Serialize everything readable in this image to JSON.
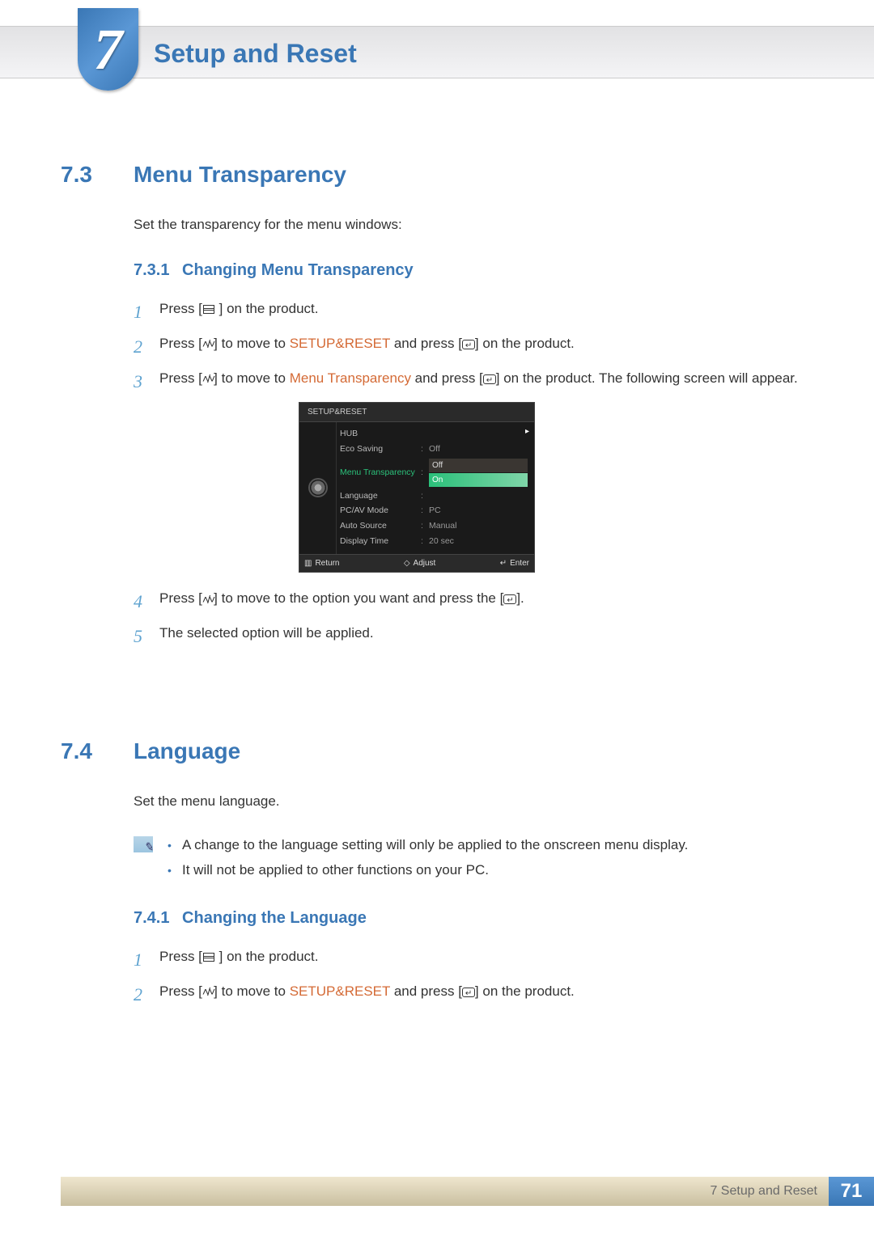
{
  "chapter": {
    "number": "7",
    "title": "Setup and Reset"
  },
  "section_73": {
    "num": "7.3",
    "title": "Menu Transparency",
    "intro": "Set the transparency for the menu windows:",
    "sub_num": "7.3.1",
    "sub_title": "Changing Menu Transparency",
    "step1": "on the product.",
    "step1_pre": "Press [",
    "step1_post": " ] ",
    "step2a": "Press [",
    "step2b": "] to move to ",
    "step2_hl": "SETUP&RESET",
    "step2c": " and press [",
    "step2d": "] on the product.",
    "step3a": "Press [",
    "step3b": "] to move to ",
    "step3_hl": "Menu Transparency",
    "step3c": " and press [",
    "step3d": "] on the product. The following screen will appear.",
    "step4a": "Press [",
    "step4b": "] to move to the option you want and press the [",
    "step4c": "].",
    "step5": "The selected option will be applied."
  },
  "osd": {
    "title": "SETUP&RESET",
    "rows": {
      "hub": "HUB",
      "eco": "Eco Saving",
      "eco_v": "Off",
      "trans": "Menu Transparency",
      "trans_off": "Off",
      "trans_on": "On",
      "lang": "Language",
      "pcav": "PC/AV Mode",
      "pcav_v": "PC",
      "auto": "Auto Source",
      "auto_v": "Manual",
      "disp": "Display Time",
      "disp_v": "20 sec"
    },
    "foot": {
      "return": "Return",
      "adjust": "Adjust",
      "enter": "Enter"
    }
  },
  "section_74": {
    "num": "7.4",
    "title": "Language",
    "intro": "Set the menu language.",
    "note1": "A change to the language setting will only be applied to the onscreen menu display.",
    "note2": "It will not be applied to other functions on your PC.",
    "sub_num": "7.4.1",
    "sub_title": "Changing the Language",
    "step1_pre": "Press [",
    "step1_post": " ] ",
    "step1": "on the product.",
    "step2a": "Press [",
    "step2b": "] to move to ",
    "step2_hl": "SETUP&RESET",
    "step2c": " and press [",
    "step2d": "] on the product."
  },
  "footer": {
    "label": "7 Setup and Reset",
    "page": "71"
  }
}
